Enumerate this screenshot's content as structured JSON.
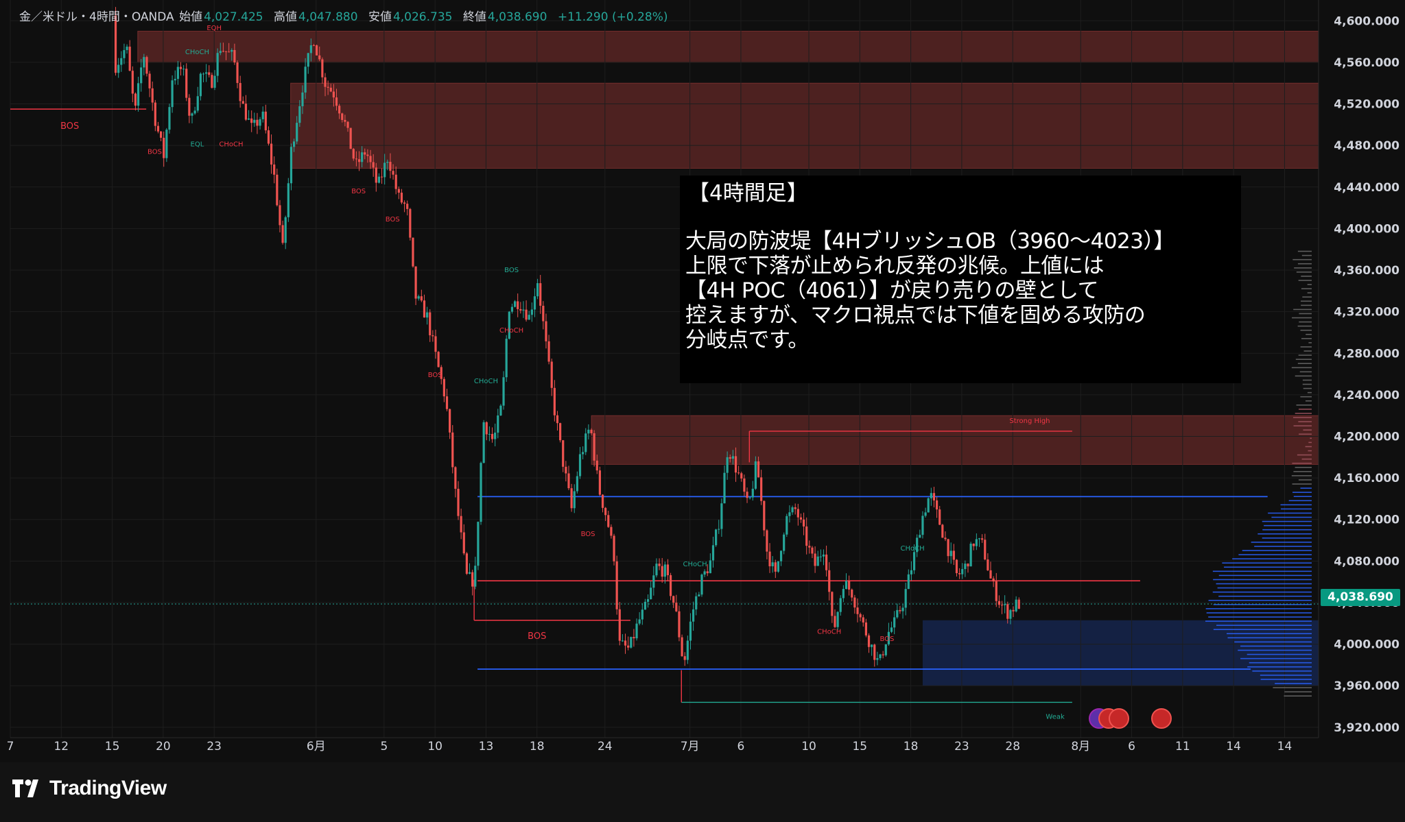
{
  "legend": {
    "symbol": "金／米ドル・4時間・OANDA",
    "open_label": "始値",
    "open": "4,027.425",
    "high_label": "高値",
    "high": "4,047.880",
    "low_label": "安値",
    "low": "4,026.735",
    "close_label": "終値",
    "close": "4,038.690",
    "change": "+11.290 (+0.28%)"
  },
  "annotation": {
    "heading": "【4時間足】",
    "lines": [
      "大局の防波堤【4HブリッシュOB（3960〜4023）】",
      "上限で下落が止められ反発の兆候。上値には",
      "【4H POC（4061）】が戻り売りの壁として",
      "控えますが、マクロ視点では下値を固める攻防の",
      "分岐点です。"
    ]
  },
  "current_price": "4,038.690",
  "branding": {
    "name": "TradingView"
  },
  "colors": {
    "up": "#26a69a",
    "down": "#ef5350",
    "supply_zone": "#ef5350",
    "demand_zone": "#2962ff",
    "smc_bear": "#f23645",
    "smc_bull": "#22ab94",
    "range_line": "#2962ff",
    "poc_line": "#f23645"
  },
  "chart_data": {
    "type": "candlestick",
    "timeframe": "4H",
    "ylim": [
      3910,
      4620
    ],
    "y_ticks": [
      3920,
      3960,
      4000,
      4040,
      4080,
      4120,
      4160,
      4200,
      4240,
      4280,
      4320,
      4360,
      4400,
      4440,
      4480,
      4520,
      4560,
      4600
    ],
    "y_tick_labels": [
      "3,920.000",
      "3,960.000",
      "4,000.000",
      "4,040.000",
      "4,080.000",
      "4,120.000",
      "4,160.000",
      "4,200.000",
      "4,240.000",
      "4,280.000",
      "4,320.000",
      "4,360.000",
      "4,400.000",
      "4,440.000",
      "4,480.000",
      "4,520.000",
      "4,560.000",
      "4,600.000"
    ],
    "x_axis": {
      "units": "trading days",
      "range": [
        -1.5,
        75.5
      ],
      "ticks": [
        {
          "label": "7",
          "day": -1.5
        },
        {
          "label": "12",
          "day": 1.5
        },
        {
          "label": "15",
          "day": 4.5
        },
        {
          "label": "20",
          "day": 7.5
        },
        {
          "label": "23",
          "day": 10.5
        },
        {
          "label": "6月",
          "day": 16.5
        },
        {
          "label": "5",
          "day": 20.5
        },
        {
          "label": "10",
          "day": 23.5
        },
        {
          "label": "13",
          "day": 26.5
        },
        {
          "label": "18",
          "day": 29.5
        },
        {
          "label": "24",
          "day": 33.5
        },
        {
          "label": "7月",
          "day": 38.5
        },
        {
          "label": "6",
          "day": 41.5
        },
        {
          "label": "10",
          "day": 45.5
        },
        {
          "label": "15",
          "day": 48.5
        },
        {
          "label": "18",
          "day": 51.5
        },
        {
          "label": "23",
          "day": 54.5
        },
        {
          "label": "28",
          "day": 57.5
        },
        {
          "label": "8月",
          "day": 61.5
        },
        {
          "label": "6",
          "day": 64.5
        },
        {
          "label": "11",
          "day": 67.5
        },
        {
          "label": "14",
          "day": 70.5
        },
        {
          "label": "14",
          "day": 73.5
        }
      ]
    },
    "price_path": [
      [
        4.7,
        4605
      ],
      [
        4.8,
        4555
      ],
      [
        5.5,
        4575
      ],
      [
        6.0,
        4510
      ],
      [
        6.5,
        4570
      ],
      [
        7.2,
        4505
      ],
      [
        7.7,
        4470
      ],
      [
        8.2,
        4545
      ],
      [
        8.8,
        4555
      ],
      [
        9.3,
        4500
      ],
      [
        9.9,
        4550
      ],
      [
        10.5,
        4540
      ],
      [
        11.0,
        4575
      ],
      [
        11.8,
        4565
      ],
      [
        12.3,
        4520
      ],
      [
        12.9,
        4495
      ],
      [
        13.5,
        4510
      ],
      [
        14.2,
        4450
      ],
      [
        14.7,
        4380
      ],
      [
        15.2,
        4475
      ],
      [
        15.9,
        4540
      ],
      [
        16.5,
        4585
      ],
      [
        17.2,
        4540
      ],
      [
        17.7,
        4530
      ],
      [
        18.3,
        4505
      ],
      [
        19.0,
        4460
      ],
      [
        19.6,
        4475
      ],
      [
        20.3,
        4440
      ],
      [
        20.9,
        4470
      ],
      [
        21.5,
        4430
      ],
      [
        22.0,
        4420
      ],
      [
        22.5,
        4335
      ],
      [
        23.2,
        4315
      ],
      [
        23.8,
        4270
      ],
      [
        24.3,
        4235
      ],
      [
        24.9,
        4140
      ],
      [
        25.5,
        4065
      ],
      [
        26.0,
        4060
      ],
      [
        26.5,
        4215
      ],
      [
        27.1,
        4195
      ],
      [
        27.6,
        4230
      ],
      [
        28.0,
        4325
      ],
      [
        28.6,
        4330
      ],
      [
        29.2,
        4315
      ],
      [
        29.7,
        4350
      ],
      [
        30.1,
        4300
      ],
      [
        30.6,
        4235
      ],
      [
        31.2,
        4175
      ],
      [
        31.7,
        4130
      ],
      [
        32.2,
        4180
      ],
      [
        32.8,
        4210
      ],
      [
        33.3,
        4150
      ],
      [
        33.8,
        4120
      ],
      [
        34.2,
        4085
      ],
      [
        34.5,
        4000
      ],
      [
        35.1,
        3995
      ],
      [
        35.6,
        4020
      ],
      [
        36.2,
        4040
      ],
      [
        36.7,
        4075
      ],
      [
        37.2,
        4070
      ],
      [
        37.8,
        4035
      ],
      [
        38.3,
        3980
      ],
      [
        38.8,
        4030
      ],
      [
        39.3,
        4060
      ],
      [
        39.9,
        4080
      ],
      [
        40.4,
        4120
      ],
      [
        40.9,
        4190
      ],
      [
        41.6,
        4160
      ],
      [
        42.1,
        4130
      ],
      [
        42.6,
        4175
      ],
      [
        43.2,
        4090
      ],
      [
        43.7,
        4065
      ],
      [
        44.3,
        4120
      ],
      [
        44.9,
        4130
      ],
      [
        45.4,
        4105
      ],
      [
        46.0,
        4075
      ],
      [
        46.6,
        4095
      ],
      [
        47.1,
        4010
      ],
      [
        47.7,
        4060
      ],
      [
        48.2,
        4050
      ],
      [
        48.7,
        4025
      ],
      [
        49.3,
        4000
      ],
      [
        49.8,
        3980
      ],
      [
        50.3,
        4010
      ],
      [
        50.7,
        4020
      ],
      [
        51.2,
        4040
      ],
      [
        51.8,
        4080
      ],
      [
        52.3,
        4120
      ],
      [
        52.8,
        4145
      ],
      [
        53.3,
        4120
      ],
      [
        53.9,
        4090
      ],
      [
        54.4,
        4065
      ],
      [
        54.9,
        4075
      ],
      [
        55.4,
        4100
      ],
      [
        55.9,
        4095
      ],
      [
        56.4,
        4060
      ],
      [
        56.9,
        4040
      ],
      [
        57.4,
        4030
      ],
      [
        57.9,
        4038.69
      ]
    ],
    "supply_zones": [
      {
        "x0": 6.0,
        "x1": 75.5,
        "y0": 4560,
        "y1": 4590
      },
      {
        "x0": 15.0,
        "x1": 75.5,
        "y0": 4458,
        "y1": 4540
      },
      {
        "x0": 32.7,
        "x1": 75.5,
        "y0": 4173,
        "y1": 4220
      }
    ],
    "demand_zone": {
      "x0": 52.2,
      "x1": 75.5,
      "y0": 3960,
      "y1": 4023
    },
    "range_lines": [
      {
        "x0": 26.0,
        "x1": 72.5,
        "y": 4142
      },
      {
        "x0": 26.0,
        "x1": 71.5,
        "y": 3976
      }
    ],
    "poc_line": {
      "x0": 26.0,
      "x1": 65.0,
      "y": 4061
    },
    "strong_high_line": {
      "x0": 42.0,
      "x1": 61.0,
      "y": 4205
    },
    "weak_low_line": {
      "x0": 38.0,
      "x1": 61.0,
      "y": 3944
    },
    "bos_left_line": {
      "x0": -1.5,
      "x1": 6.5,
      "y": 4515
    },
    "bos_mid_line": {
      "x0": 25.8,
      "x1": 35.0,
      "y": 4023
    },
    "smc_labels": [
      {
        "text": "BOS",
        "x": 2.0,
        "y": 4496,
        "kind": "bear",
        "size": "big"
      },
      {
        "text": "BOS",
        "x": 7.0,
        "y": 4472,
        "kind": "bear",
        "size": "small"
      },
      {
        "text": "EQL",
        "x": 9.5,
        "y": 4479,
        "kind": "bull",
        "size": "small"
      },
      {
        "text": "CHoCH",
        "x": 11.5,
        "y": 4479,
        "kind": "bear",
        "size": "small"
      },
      {
        "text": "CHoCH",
        "x": 9.5,
        "y": 4568,
        "kind": "bull",
        "size": "small"
      },
      {
        "text": "EQH",
        "x": 10.5,
        "y": 4591,
        "kind": "bear",
        "size": "small"
      },
      {
        "text": "BOS",
        "x": 19.0,
        "y": 4434,
        "kind": "bear",
        "size": "small"
      },
      {
        "text": "BOS",
        "x": 21.0,
        "y": 4407,
        "kind": "bear",
        "size": "small"
      },
      {
        "text": "BOS",
        "x": 28.0,
        "y": 4358,
        "kind": "bull",
        "size": "small"
      },
      {
        "text": "CHoCH",
        "x": 28.0,
        "y": 4300,
        "kind": "bear",
        "size": "small"
      },
      {
        "text": "CHoCH",
        "x": 26.5,
        "y": 4251,
        "kind": "bull",
        "size": "small"
      },
      {
        "text": "BOS",
        "x": 23.5,
        "y": 4257,
        "kind": "bear",
        "size": "small"
      },
      {
        "text": "BOS",
        "x": 32.5,
        "y": 4104,
        "kind": "bear",
        "size": "small"
      },
      {
        "text": "BOS",
        "x": 29.5,
        "y": 4005,
        "kind": "bear",
        "size": "big"
      },
      {
        "text": "CHoCH",
        "x": 38.8,
        "y": 4075,
        "kind": "bull",
        "size": "small"
      },
      {
        "text": "CHoCH",
        "x": 46.7,
        "y": 4010,
        "kind": "bear",
        "size": "small"
      },
      {
        "text": "BOS",
        "x": 50.1,
        "y": 4003,
        "kind": "bear",
        "size": "small"
      },
      {
        "text": "CHoCH",
        "x": 51.6,
        "y": 4090,
        "kind": "bull",
        "size": "small"
      },
      {
        "text": "Strong High",
        "x": 58.5,
        "y": 4213,
        "kind": "bear",
        "size": "small"
      },
      {
        "text": "Weak",
        "x": 60.0,
        "y": 3928,
        "kind": "bull",
        "size": "small"
      }
    ],
    "volume_profile": {
      "rows_from_price": 4380,
      "rows_to_price": 3950,
      "poc_price": 4061,
      "value_area": [
        3960,
        4150
      ]
    }
  }
}
